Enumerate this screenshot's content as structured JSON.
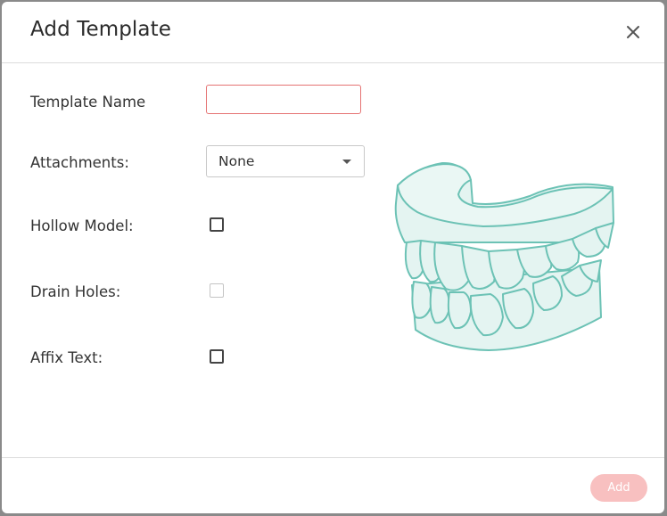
{
  "dialog": {
    "title": "Add Template",
    "close_icon": "close-icon"
  },
  "form": {
    "template_name": {
      "label": "Template Name",
      "value": ""
    },
    "attachments": {
      "label": "Attachments:",
      "selected": "None"
    },
    "hollow_model": {
      "label": "Hollow Model:",
      "checked": false
    },
    "drain_holes": {
      "label": "Drain Holes:",
      "checked": false,
      "disabled": true
    },
    "affix_text": {
      "label": "Affix Text:",
      "checked": false
    }
  },
  "illustration": {
    "icon": "dental-model-icon",
    "stroke": "#6cc2b5",
    "fill": "#e4f4f1"
  },
  "footer": {
    "add_label": "Add"
  },
  "colors": {
    "add_button_disabled": "#f8c0c0",
    "input_error_border": "#e57373"
  }
}
